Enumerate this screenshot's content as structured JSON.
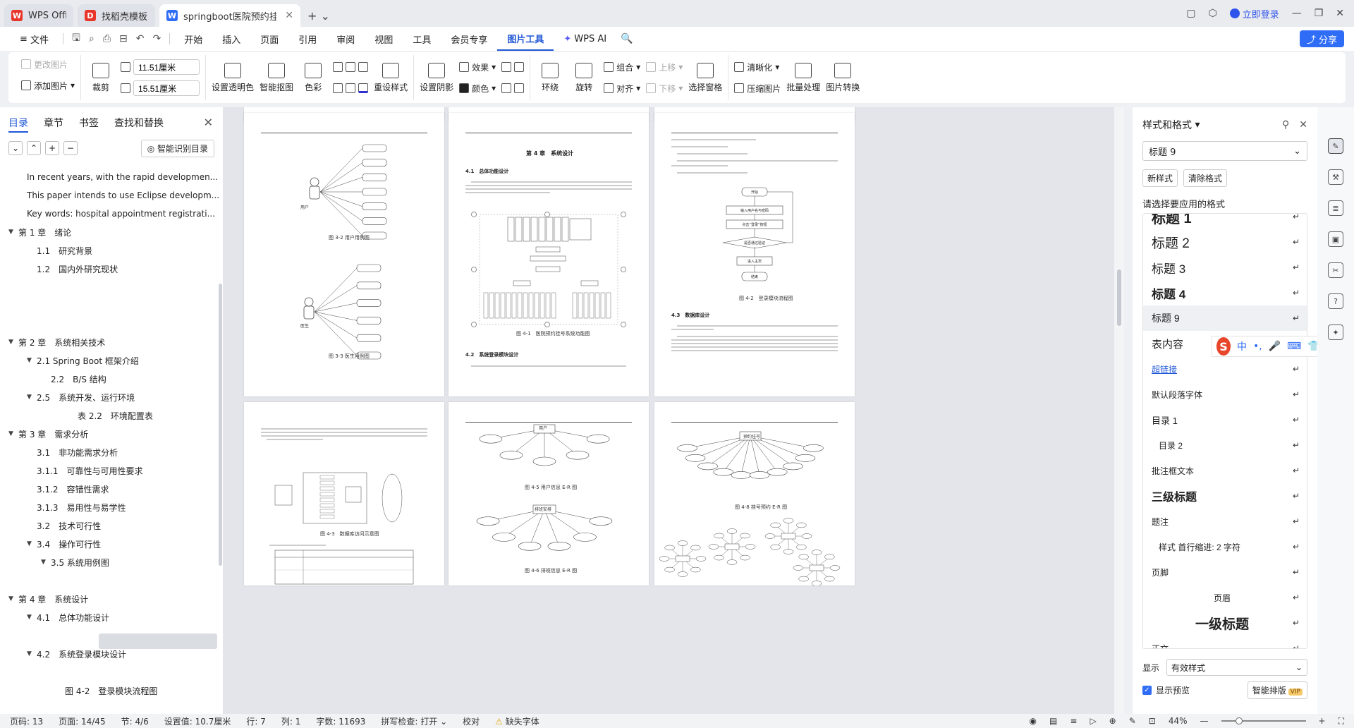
{
  "tabs": [
    {
      "label": "WPS Office",
      "color": "#e8362b",
      "glyph": "W"
    },
    {
      "label": "找稻壳模板",
      "color": "#e8362b",
      "glyph": "D"
    },
    {
      "label": "springboot医院预约挂号系统",
      "color": "#2f6df6",
      "glyph": "W",
      "active": true
    }
  ],
  "titlebar": {
    "login": "立即登录"
  },
  "menu": {
    "file": "文件",
    "items": [
      "开始",
      "插入",
      "页面",
      "引用",
      "审阅",
      "视图",
      "工具",
      "会员专享",
      "图片工具"
    ],
    "active": "图片工具",
    "wps_ai": "WPS AI",
    "share": "分享"
  },
  "ribbon": {
    "change_image": "更改图片",
    "add_image": "添加图片",
    "crop": "裁剪",
    "width": "11.51厘米",
    "height": "15.51厘米",
    "set_transparent": "设置透明色",
    "smart_cutout": "智能抠图",
    "color": "色彩",
    "reset_style": "重设样式",
    "set_shadow": "设置阴影",
    "effects": "效果",
    "border_color": "颜色",
    "wrap": "环绕",
    "rotate": "旋转",
    "group": "组合",
    "align": "对齐",
    "up": "上移",
    "down": "下移",
    "select_pane": "选择窗格",
    "clarify": "清晰化",
    "compress": "压缩图片",
    "batch": "批量处理",
    "convert": "图片转换"
  },
  "leftpanel": {
    "tabs": [
      "目录",
      "章节",
      "书签",
      "查找和替换"
    ],
    "smart_toc": "智能识别目录",
    "toc": [
      {
        "label": "In recent years, with the rapid developmen...",
        "indent": 0
      },
      {
        "label": "This paper intends to use Eclipse developm...",
        "indent": 0
      },
      {
        "label": "Key words: hospital appointment registrati...",
        "indent": 0
      },
      {
        "label": "第 1 章　绪论",
        "indent": 0,
        "arrow": true
      },
      {
        "label": "1.1　研究背景",
        "indent": 1
      },
      {
        "label": "1.2　国内外研究现状",
        "indent": 1
      },
      {
        "label": "",
        "indent": 1
      },
      {
        "label": "",
        "indent": 1
      },
      {
        "label": "",
        "indent": 1
      },
      {
        "label": "第 2 章　系统相关技术",
        "indent": 0,
        "arrow": true
      },
      {
        "label": "2.1 Spring Boot 框架介绍",
        "indent": 1,
        "arrow": true
      },
      {
        "label": "2.2　B/S 结构",
        "indent": 2
      },
      {
        "label": "2.5　系统开发、运行环境",
        "indent": 1,
        "arrow": true
      },
      {
        "label": "表 2.2　环境配置表",
        "indent": 4
      },
      {
        "label": "第 3 章　需求分析",
        "indent": 0,
        "arrow": true
      },
      {
        "label": "3.1　非功能需求分析",
        "indent": 1
      },
      {
        "label": "3.1.1　可靠性与可用性要求",
        "indent": 1
      },
      {
        "label": "3.1.2　容错性需求",
        "indent": 1
      },
      {
        "label": "3.1.3　易用性与易学性",
        "indent": 1
      },
      {
        "label": "3.2　技术可行性",
        "indent": 1
      },
      {
        "label": "3.4　操作可行性",
        "indent": 1,
        "arrow": true
      },
      {
        "label": "3.5 系统用例图",
        "indent": 2,
        "arrow": true
      },
      {
        "label": "",
        "indent": 1
      },
      {
        "label": "第 4 章　系统设计",
        "indent": 0,
        "arrow": true
      },
      {
        "label": "4.1　总体功能设计",
        "indent": 1,
        "arrow": true
      },
      {
        "label": "",
        "indent": 1
      },
      {
        "label": "4.2　系统登录模块设计",
        "indent": 1,
        "arrow": true
      },
      {
        "label": "",
        "indent": 1
      },
      {
        "label": "图 4-2　登录模块流程图",
        "indent": 3
      }
    ]
  },
  "pages": {
    "p1_caption_a": "图 3-2 用户用例图",
    "p1_caption_b": "图 3-3 医生用例图",
    "p1_actor_a": "用户",
    "p1_actor_b": "医生",
    "p2_title": "第 4 章　系统设计",
    "p2_h1": "4.1　总体功能设计",
    "p2_caption": "图 4-1　医院预约挂号系统功能图",
    "p2_h2": "4.2　系统登录模块设计",
    "p3_caption": "图 4-2　登录模块流程图",
    "p3_h": "4.3　数据库设计",
    "p3_flow": [
      "开始",
      "输入用户名与密码",
      "点击“登录”按钮",
      "是否通过验证",
      "进入主页",
      "结束"
    ],
    "p4_caption": "图 4-3　数据库访问示意图",
    "p5_caption_a": "图 4-5 用户信息 E-R 图",
    "p5_caption_b": "图 4-6 排班信息 E-R 图",
    "p5_center_a": "用户",
    "p5_center_b": "排班安排",
    "p6_caption": "图 4-8 挂号预约 E-R 图",
    "p6_center": "预约挂号"
  },
  "rightpanel": {
    "title": "样式和格式",
    "current": "标题 9",
    "new_style": "新样式",
    "clear_format": "清除格式",
    "apply_label": "请选择要应用的格式",
    "styles": [
      {
        "label": "标题 1",
        "size": 20,
        "bold": true
      },
      {
        "label": "标题 2",
        "size": 19,
        "bold": false
      },
      {
        "label": "标题 3",
        "size": 17,
        "bold": false
      },
      {
        "label": "标题 4",
        "size": 17,
        "bold": true
      },
      {
        "label": "标题 9",
        "size": 14,
        "bold": false,
        "selected": true
      },
      {
        "label": "表内容",
        "size": 15,
        "bold": false
      },
      {
        "label": "超链接",
        "size": 12,
        "bold": false,
        "link": true
      },
      {
        "label": "默认段落字体",
        "size": 12,
        "bold": false
      },
      {
        "label": "目录 1",
        "size": 13,
        "bold": false
      },
      {
        "label": "目录 2",
        "size": 12,
        "bold": false,
        "indent": 10
      },
      {
        "label": "批注框文本",
        "size": 12,
        "bold": false
      },
      {
        "label": "三级标题",
        "size": 16,
        "bold": true
      },
      {
        "label": "题注",
        "size": 12,
        "bold": false
      },
      {
        "label": "样式 首行缩进:  2 字符",
        "size": 12,
        "bold": false,
        "indent": 10
      },
      {
        "label": "页脚",
        "size": 12,
        "bold": false
      },
      {
        "label": "页眉",
        "size": 12,
        "bold": false,
        "center": true
      },
      {
        "label": "一级标题",
        "size": 19,
        "bold": true,
        "center": true
      },
      {
        "label": "正文",
        "size": 12,
        "bold": false
      }
    ],
    "show_label": "显示",
    "show_value": "有效样式",
    "preview": "显示预览",
    "smart_layout": "智能排版",
    "vip": "VIP"
  },
  "ime": {
    "items": [
      "中",
      "•,",
      "🎤",
      "⌨",
      "👕",
      "🎮",
      "⊞"
    ]
  },
  "status": {
    "page_num": "页码: 13",
    "page": "页面: 14/45",
    "section": "节: 4/6",
    "setting": "设置值: 10.7厘米",
    "row": "行: 7",
    "col": "列: 1",
    "words": "字数: 11693",
    "spell": "拼写检查: 打开",
    "proof": "校对",
    "missing_font": "缺失字体",
    "zoom": "44%"
  }
}
